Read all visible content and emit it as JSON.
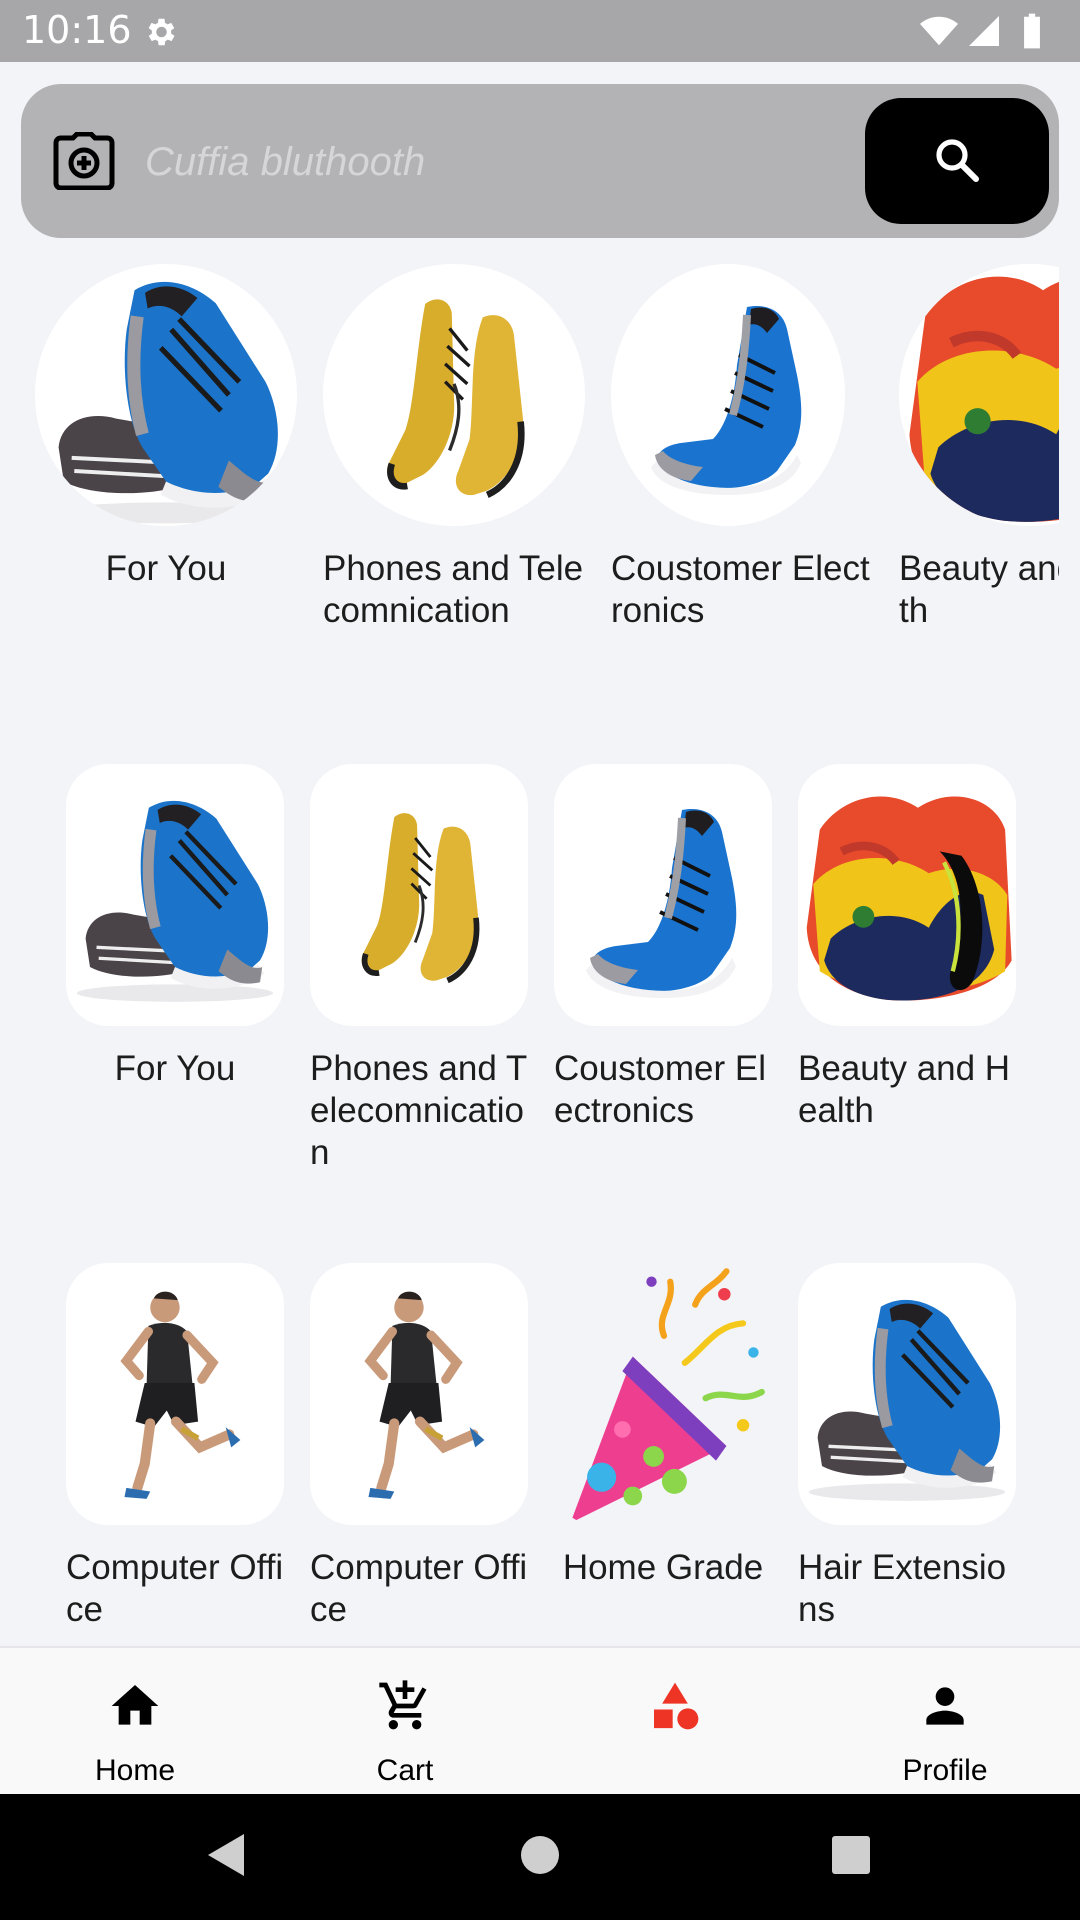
{
  "status_bar": {
    "time": "10:16",
    "icons": [
      "gear-icon",
      "wifi-icon",
      "signal-icon",
      "battery-icon"
    ]
  },
  "search": {
    "placeholder": "Cuffia bluthooth",
    "camera_icon": "camera-icon",
    "search_icon": "search-icon"
  },
  "rows": [
    {
      "style": "circle",
      "items": [
        {
          "label": "For You",
          "image": "blue-sneaker-pair"
        },
        {
          "label": "Phones and Telecomnication",
          "image": "yellow-boots"
        },
        {
          "label": "Coustomer Electronics",
          "image": "blue-sneaker"
        },
        {
          "label": "Beauty and Health",
          "image": "abstract-painting"
        }
      ]
    },
    {
      "style": "rounded",
      "items": [
        {
          "label": "For You",
          "image": "blue-sneaker-pair"
        },
        {
          "label": "Phones and Telecomnication",
          "image": "yellow-boots"
        },
        {
          "label": "Coustomer Electronics",
          "image": "blue-sneaker"
        },
        {
          "label": "Beauty and Health",
          "image": "abstract-painting"
        }
      ]
    },
    {
      "style": "rounded",
      "items": [
        {
          "label": "Computer Office",
          "image": "running-man"
        },
        {
          "label": "Computer Office",
          "image": "running-man"
        },
        {
          "label": "Home Grade",
          "image": "party-popper"
        },
        {
          "label": "Hair Extensions",
          "image": "blue-sneaker-pair"
        }
      ]
    }
  ],
  "bottom_nav": {
    "items": [
      {
        "label": "Home",
        "icon": "home-icon",
        "active": false
      },
      {
        "label": "Cart",
        "icon": "add-cart-icon",
        "active": false
      },
      {
        "label": "",
        "icon": "categories-icon",
        "active": true
      },
      {
        "label": "Profile",
        "icon": "person-icon",
        "active": false
      }
    ]
  },
  "colors": {
    "active": "#ee3425",
    "search_button": "#000000",
    "search_bar": "#b3b3b5"
  },
  "system_nav": [
    "back-icon",
    "home-circle-icon",
    "recents-icon"
  ]
}
